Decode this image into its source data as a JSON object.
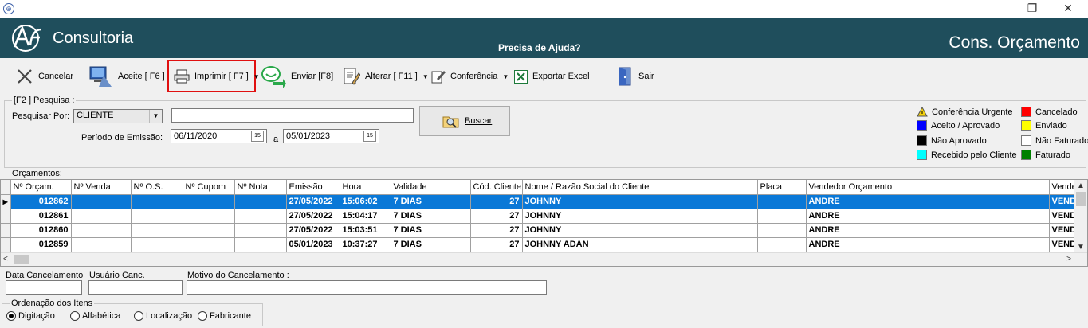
{
  "window": {
    "app_icon": "cart-icon",
    "restore_glyph": "❐",
    "close_glyph": "✕"
  },
  "header": {
    "brand": "Consultoria",
    "help": "Precisa de Ajuda?",
    "form_title": "Cons. Orçamento",
    "background": "#1f4e5c"
  },
  "toolbar": {
    "cancelar": "Cancelar",
    "aceite": "Aceite  [ F6 ]",
    "imprimir": "Imprimir [ F7 ]",
    "enviar": "Enviar [F8]",
    "alterar": "Alterar [ F11 ]",
    "conferencia": "Conferência",
    "exportar": "Exportar Excel",
    "sair": "Sair",
    "highlight_color": "#e01010"
  },
  "pesquisa": {
    "group_label": "[F2 ]  Pesquisa :",
    "pesquisar_por_label": "Pesquisar Por:",
    "pesquisar_por_value": "CLIENTE",
    "search_text": "",
    "periodo_label": "Período de Emissão:",
    "date_from": "06/11/2020",
    "date_sep": "a",
    "date_to": "05/01/2023",
    "buscar": "Buscar"
  },
  "legend": [
    {
      "label": "Conferência Urgente",
      "icon": "warning-icon",
      "color": "#f5d20a"
    },
    {
      "label": "Cancelado",
      "color": "#ff0000"
    },
    {
      "label": "Aceito / Aprovado",
      "color": "#0000ff"
    },
    {
      "label": "Enviado",
      "color": "#ffff00"
    },
    {
      "label": "Não Aprovado",
      "color": "#000000"
    },
    {
      "label": "Não Faturado",
      "color": "#ffffff"
    },
    {
      "label": "Recebido pelo Cliente",
      "color": "#00ffff"
    },
    {
      "label": "Faturado",
      "color": "#008000"
    }
  ],
  "orcamentos": {
    "label": "Orçamentos:",
    "columns": [
      "Nº Orçam.",
      "Nº Venda",
      "Nº O.S.",
      "Nº Cupom",
      "Nº Nota",
      "Emissão",
      "Hora",
      "Validade",
      "Cód. Cliente",
      "Nome / Razão Social do Cliente",
      "Placa",
      "Vendedor Orçamento",
      "Vende"
    ],
    "rows": [
      [
        "012862",
        "",
        "",
        "",
        "",
        "27/05/2022",
        "15:06:02",
        "7 DIAS",
        "27",
        "JOHNNY",
        "",
        "ANDRE",
        "VENDE"
      ],
      [
        "012861",
        "",
        "",
        "",
        "",
        "27/05/2022",
        "15:04:17",
        "7 DIAS",
        "27",
        "JOHNNY",
        "",
        "ANDRE",
        "VENDE"
      ],
      [
        "012860",
        "",
        "",
        "",
        "",
        "27/05/2022",
        "15:03:51",
        "7 DIAS",
        "27",
        "JOHNNY",
        "",
        "ANDRE",
        "VENDE"
      ],
      [
        "012859",
        "",
        "",
        "",
        "",
        "05/01/2023",
        "10:37:27",
        "7 DIAS",
        "27",
        "JOHNNY ADAN",
        "",
        "ANDRE",
        "VENDE"
      ]
    ],
    "selected_row": 0,
    "selection_color": "#0a78d7"
  },
  "cancelamento": {
    "data_label": "Data Cancelamento",
    "usuario_label": "Usuário Canc.",
    "motivo_label": "Motivo do Cancelamento  :",
    "data_value": "",
    "usuario_value": "",
    "motivo_value": ""
  },
  "ordenacao": {
    "label": "Ordenação dos Itens",
    "options": [
      "Digitação",
      "Alfabética",
      "Localização",
      "Fabricante"
    ],
    "selected": "Digitação"
  }
}
